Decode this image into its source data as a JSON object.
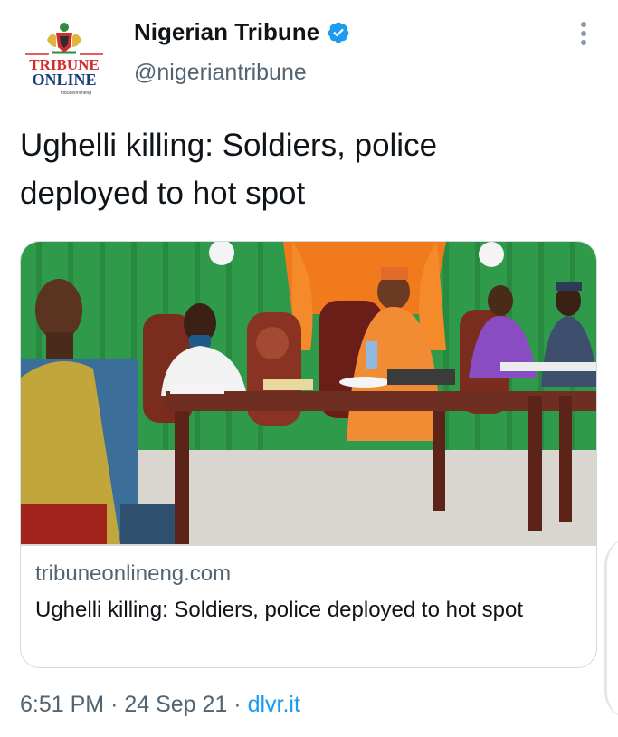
{
  "author": {
    "name": "Nigerian Tribune",
    "handle": "@nigeriantribune",
    "verified": true,
    "avatar_logo": {
      "line1": "TRIBUNE",
      "line2": "ONLINE",
      "subtext": "tribuneonlineng"
    }
  },
  "tweet": {
    "text_line1": "Ughelli killing: Soldiers, police",
    "text_line2": "deployed to hot spot"
  },
  "card": {
    "domain": "tribuneonlineng.com",
    "title": "Ughelli killing: Soldiers, police deployed to hot spot"
  },
  "meta": {
    "time": "6:51 PM",
    "separator": "·",
    "date": "24 Sep 21",
    "source": "dlvr.it"
  },
  "colors": {
    "verified_badge": "#1d9bf0",
    "link": "#1d9bf0",
    "secondary_text": "#536471",
    "logo_red": "#d32b2b",
    "logo_navy": "#1c3f7a"
  },
  "icons": {
    "verified": "verified-badge-icon",
    "more": "more-options-icon"
  }
}
